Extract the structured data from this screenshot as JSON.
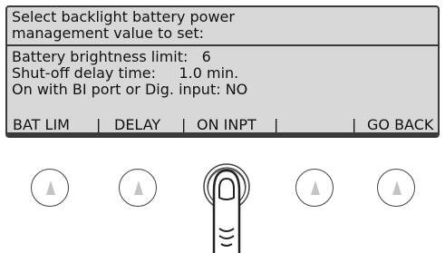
{
  "screen": {
    "header_line1": "Select backlight battery power",
    "header_line2": "management value to set:",
    "battery_line": "Battery brightness limit:   6",
    "delay_line": "Shut-off delay time:     1.0 min.",
    "input_line": "On with BI port or Dig. input: NO"
  },
  "softkeys": [
    {
      "label": "BAT LIM"
    },
    {
      "label": "DELAY"
    },
    {
      "label": "ON INPT"
    },
    {
      "label": ""
    },
    {
      "label": "GO BACK"
    }
  ],
  "divider_char": "|",
  "buttons": [
    {
      "icon": "up-arrow-icon"
    },
    {
      "icon": "up-arrow-icon"
    },
    {
      "icon": "up-arrow-icon",
      "pressed": true
    },
    {
      "icon": "up-arrow-icon"
    },
    {
      "icon": "up-arrow-icon"
    }
  ],
  "colors": {
    "lcd_background": "#d8d8d8",
    "text": "#111111",
    "arrow": "#c4c4c4"
  }
}
